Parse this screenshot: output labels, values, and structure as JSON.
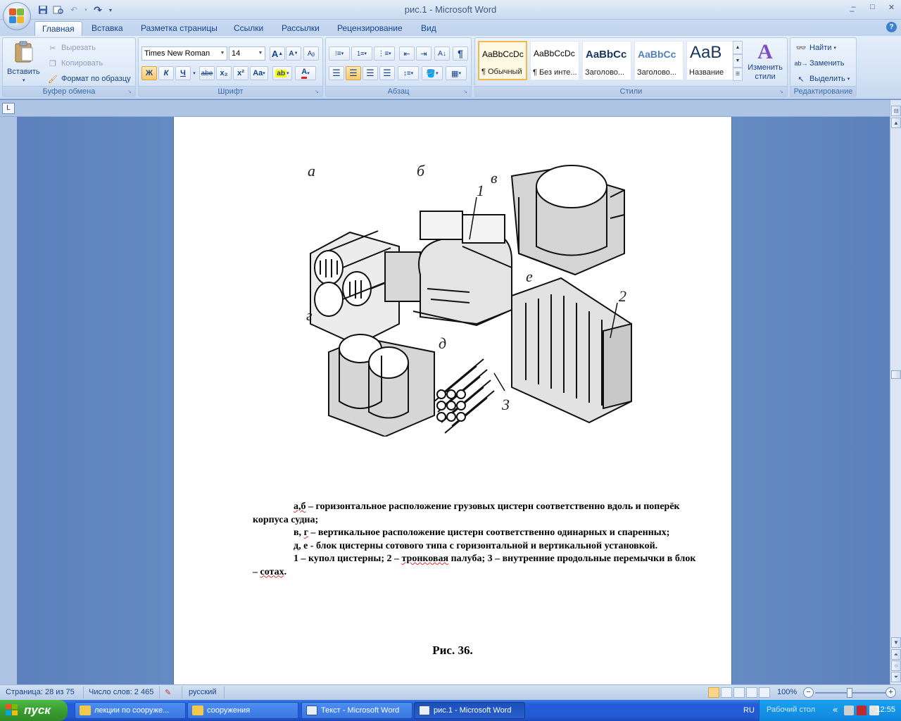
{
  "window": {
    "title": "рис.1 - Microsoft Word",
    "minimize": "–",
    "maximize": "□",
    "close": "✕",
    "app_min": "–",
    "app_restore": "❐",
    "app_close": "✕"
  },
  "tabs": [
    {
      "label": "Главная",
      "active": true
    },
    {
      "label": "Вставка"
    },
    {
      "label": "Разметка страницы"
    },
    {
      "label": "Ссылки"
    },
    {
      "label": "Рассылки"
    },
    {
      "label": "Рецензирование"
    },
    {
      "label": "Вид"
    }
  ],
  "help_label": "?",
  "clipboard": {
    "paste": "Вставить",
    "cut": "Вырезать",
    "copy": "Копировать",
    "format_painter": "Формат по образцу",
    "group_label": "Буфер обмена"
  },
  "font": {
    "family": "Times New Roman",
    "size": "14",
    "bold": "Ж",
    "italic": "К",
    "underline": "Ч",
    "strike": "abe",
    "sub": "x₂",
    "sup": "x²",
    "case": "Aa",
    "grow": "A",
    "shrink": "A",
    "group_label": "Шрифт"
  },
  "paragraph": {
    "pilcrow": "¶",
    "group_label": "Абзац"
  },
  "styles": {
    "items": [
      {
        "sample": "AaBbCcDc",
        "name": "¶ Обычный",
        "selected": true
      },
      {
        "sample": "AaBbCcDc",
        "name": "¶ Без инте..."
      },
      {
        "sample": "AaBbCc",
        "name": "Заголово..."
      },
      {
        "sample": "AaBbCc",
        "name": "Заголово..."
      },
      {
        "sample": "AaB",
        "name": "Название"
      }
    ],
    "change": "Изменить стили",
    "group_label": "Стили"
  },
  "editing": {
    "find": "Найти",
    "replace": "Заменить",
    "select": "Выделить",
    "group_label": "Редактирование"
  },
  "document": {
    "figure_letters": [
      "а",
      "б",
      "в",
      "г",
      "д",
      "е"
    ],
    "figure_numbers": [
      "1",
      "2",
      "3"
    ],
    "caption_parts": {
      "p1a": "а,б",
      "p1b": " – горизонтальное расположение грузовых цистерн соответственно вдоль и поперёк корпуса судна;",
      "p2a": "в, ",
      "p2b": "г",
      "p2c": " – вертикальное расположение цистерн соответственно одинарных и спаренных;",
      "p3a": "д",
      "p3b": ", е -  блок цистерны сотового типа с горизонтальной и вертикальной установкой.",
      "p4a": "1 – купол цистерны; 2 – ",
      "p4b": "тронковая",
      "p4c": " палуба; 3 – внутренние продольные перемычки в блок – ",
      "p4d": "сотах",
      "p4e": "."
    },
    "figure_title": "Рис. 36."
  },
  "status": {
    "page": "Страница: 28 из 75",
    "words": "Число слов: 2 465",
    "language": "русский",
    "zoom": "100%"
  },
  "taskbar": {
    "start": "пуск",
    "items": [
      {
        "label": "лекции по сооруже...",
        "icon": "folder-icon"
      },
      {
        "label": "сооружения",
        "icon": "folder-icon"
      },
      {
        "label": "Текст - Microsoft Word",
        "icon": "word-icon"
      },
      {
        "label": "рис.1 - Microsoft Word",
        "icon": "word-icon",
        "active": true
      }
    ],
    "lang": "RU",
    "desktop": "Рабочий стол",
    "clock": "12:55"
  },
  "colors": {
    "ribbon": "#dce8f7",
    "accent": "#15428b",
    "taskbar": "#245edb",
    "start": "#3a9e2f"
  }
}
